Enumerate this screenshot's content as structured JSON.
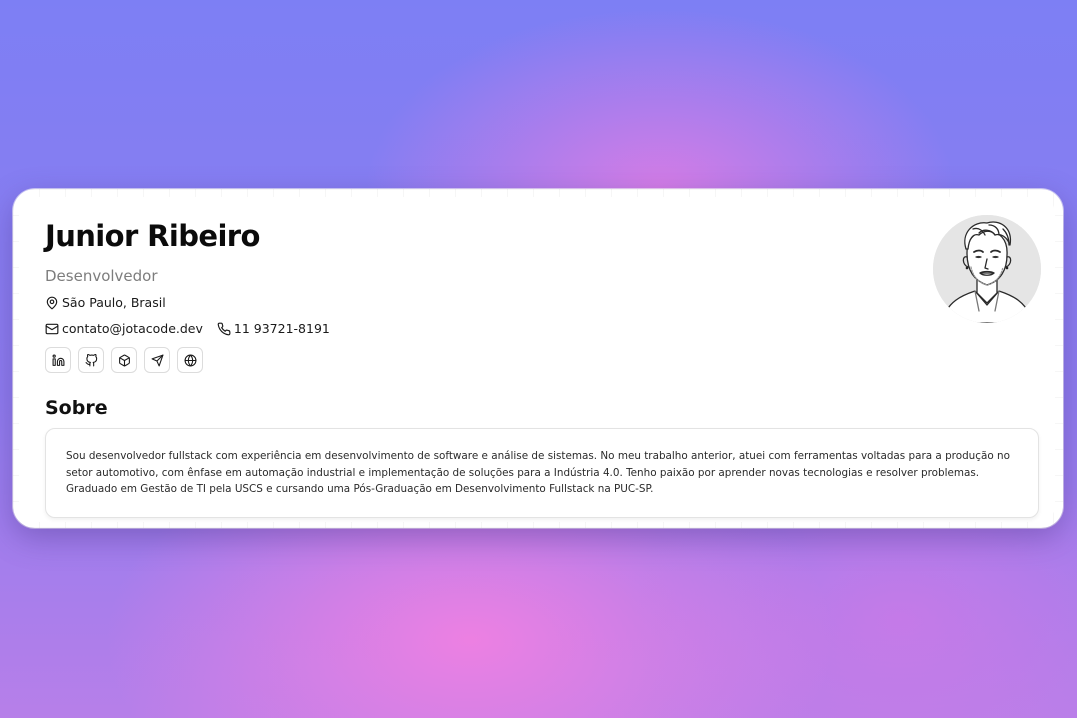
{
  "profile": {
    "name": "Junior Ribeiro",
    "role": "Desenvolvedor",
    "location": "São Paulo, Brasil",
    "email": "contato@jotacode.dev",
    "phone": "11 93721-8191",
    "location_icon": "map-pin-icon",
    "email_icon": "mail-icon",
    "phone_icon": "phone-icon",
    "avatar_icon": "avatar-illustration"
  },
  "social": [
    {
      "name": "linkedin",
      "icon": "linkedin-icon"
    },
    {
      "name": "github",
      "icon": "github-icon"
    },
    {
      "name": "npm-package",
      "icon": "package-icon"
    },
    {
      "name": "telegram",
      "icon": "send-icon"
    },
    {
      "name": "website",
      "icon": "globe-icon"
    }
  ],
  "about": {
    "title": "Sobre",
    "text": "Sou desenvolvedor fullstack com experiência em desenvolvimento de software e análise de sistemas. No meu trabalho anterior, atuei com ferramentas voltadas para a produção no setor automotivo, com ênfase em automação industrial e implementação de soluções para a Indústria 4.0. Tenho paixão por aprender novas tecnologias e resolver problemas. Graduado em Gestão de TI pela USCS e cursando uma Pós-Graduação em Desenvolvimento Fullstack na PUC-SP."
  },
  "colors": {
    "background_top": "#7d7ff4",
    "background_glow": "#f080e2",
    "card": "#ffffff",
    "text_primary": "#0b0b0b",
    "text_muted": "#7d7d7d"
  }
}
